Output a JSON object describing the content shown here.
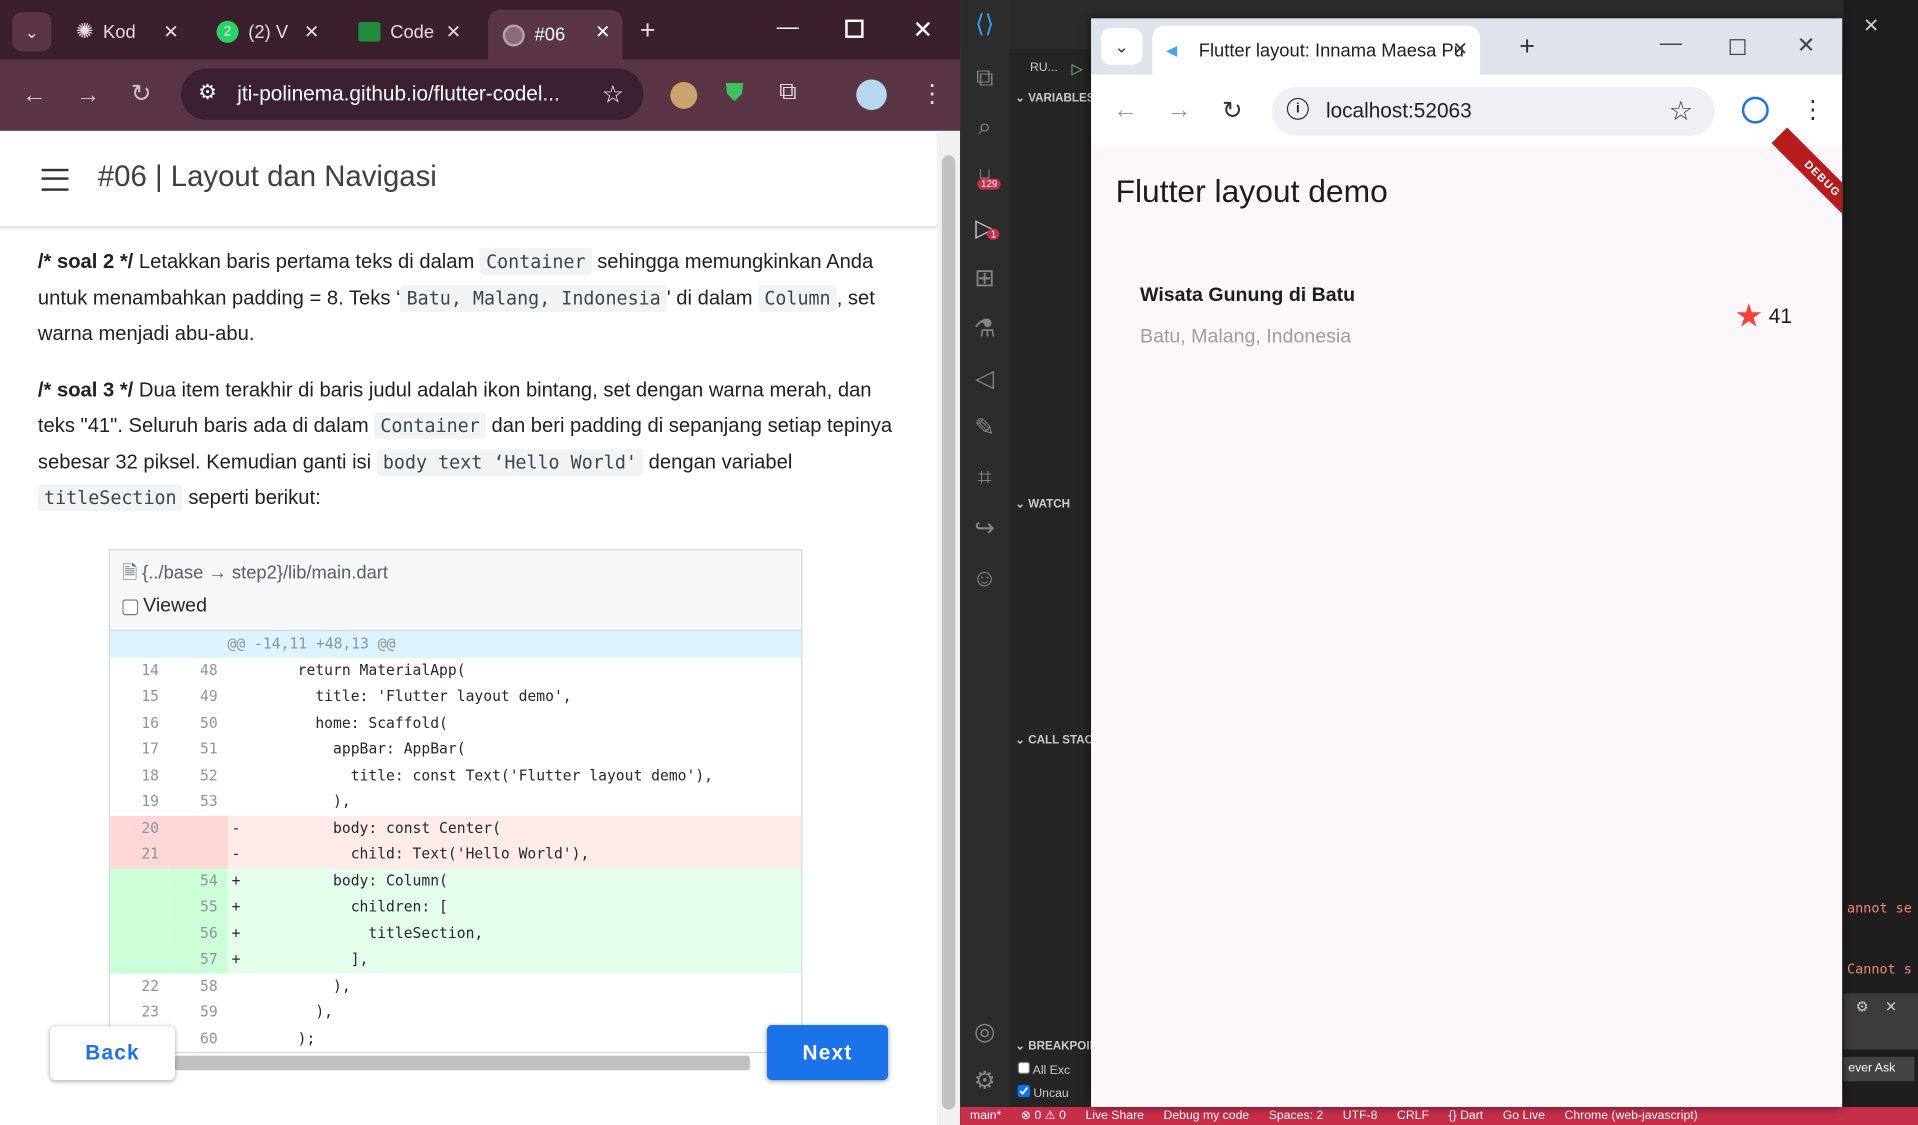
{
  "left_browser": {
    "tabs": [
      {
        "label": "Kod",
        "icon": "openai-icon"
      },
      {
        "label": "(2) V",
        "icon": "whatsapp-icon",
        "badge": "2"
      },
      {
        "label": "Code",
        "icon": "classroom-icon"
      },
      {
        "label": "#06",
        "icon": "globe-icon"
      }
    ],
    "new_tab": "+",
    "url": "jti-polinema.github.io/flutter-codel...",
    "page_title": "#06 | Layout dan Navigasi",
    "paragraph1": {
      "lead": "/* soal 2 */",
      "t1": " Letakkan baris pertama teks di dalam ",
      "c1": "Container",
      "t2": " sehingga memungkinkan Anda untuk menambahkan padding = 8. Teks ‘",
      "c2": "Batu, Malang, Indonesia",
      "t3": "' di dalam ",
      "c3": "Column",
      "t4": ", set warna menjadi abu-abu."
    },
    "paragraph2": {
      "lead": "/* soal 3 */",
      "t1": " Dua item terakhir di baris judul adalah ikon bintang, set dengan warna merah, dan teks \"41\". Seluruh baris ada di dalam ",
      "c1": "Container",
      "t2": " dan beri padding di sepanjang setiap tepinya sebesar 32 piksel. Kemudian ganti isi ",
      "c2": "body text ‘Hello World'",
      "t3": " dengan variabel ",
      "c3": "titleSection",
      "t4": " seperti berikut:"
    },
    "diff": {
      "file": "{../base → step2}/lib/main.dart",
      "viewed": "Viewed",
      "hunk": "@@ -14,11 +48,13 @@",
      "rows": [
        {
          "o": "14",
          "n": "48",
          "s": "",
          "t": "      return MaterialApp(",
          "k": "ctx"
        },
        {
          "o": "15",
          "n": "49",
          "s": "",
          "t": "        title: 'Flutter layout demo',",
          "k": "ctx"
        },
        {
          "o": "16",
          "n": "50",
          "s": "",
          "t": "        home: Scaffold(",
          "k": "ctx"
        },
        {
          "o": "17",
          "n": "51",
          "s": "",
          "t": "          appBar: AppBar(",
          "k": "ctx"
        },
        {
          "o": "18",
          "n": "52",
          "s": "",
          "t": "            title: const Text('Flutter layout demo'),",
          "k": "ctx"
        },
        {
          "o": "19",
          "n": "53",
          "s": "",
          "t": "          ),",
          "k": "ctx"
        },
        {
          "o": "20",
          "n": "",
          "s": "-",
          "t": "          body: const Center(",
          "k": "del"
        },
        {
          "o": "21",
          "n": "",
          "s": "-",
          "t": "            child: Text('Hello World'),",
          "k": "del"
        },
        {
          "o": "",
          "n": "54",
          "s": "+",
          "t": "          body: Column(",
          "k": "add"
        },
        {
          "o": "",
          "n": "55",
          "s": "+",
          "t": "            children: [",
          "k": "add"
        },
        {
          "o": "",
          "n": "56",
          "s": "+",
          "t": "              titleSection,",
          "k": "add"
        },
        {
          "o": "",
          "n": "57",
          "s": "+",
          "t": "            ],",
          "k": "add"
        },
        {
          "o": "22",
          "n": "58",
          "s": "",
          "t": "          ),",
          "k": "ctx"
        },
        {
          "o": "23",
          "n": "59",
          "s": "",
          "t": "        ),",
          "k": "ctx"
        },
        {
          "o": "24",
          "n": "60",
          "s": "",
          "t": "      );",
          "k": "ctx"
        }
      ]
    },
    "back_label": "Back",
    "next_label": "Next"
  },
  "vscode": {
    "run_label": "RU...",
    "sections": {
      "variables": "VARIABLES",
      "watch": "WATCH",
      "call_stack": "CALL STACK",
      "breakpoints": "BREAKPOINTS"
    },
    "breakpoint_items": [
      "All Exc",
      "Uncau"
    ],
    "badge_scm": "129",
    "badge_debug": "1",
    "right_text1": "annot se",
    "right_text2": "Cannot s",
    "right_text3": "ever Ask",
    "status": [
      "main*",
      "⊗ 0 ⚠ 0",
      "Live Share",
      "Debug my code",
      "Spaces: 2",
      "UTF-8",
      "CRLF",
      "{} Dart",
      "Go Live",
      "Chrome (web-javascript)"
    ]
  },
  "right_browser": {
    "tab_title": "Flutter layout: Innama Maesa Pu",
    "url": "localhost:52063",
    "app_title": "Flutter layout demo",
    "debug_banner": "DEBUG",
    "card_title": "Wisata Gunung di Batu",
    "card_subtitle": "Batu, Malang, Indonesia",
    "star_count": "41",
    "star_color": "#f44336"
  }
}
